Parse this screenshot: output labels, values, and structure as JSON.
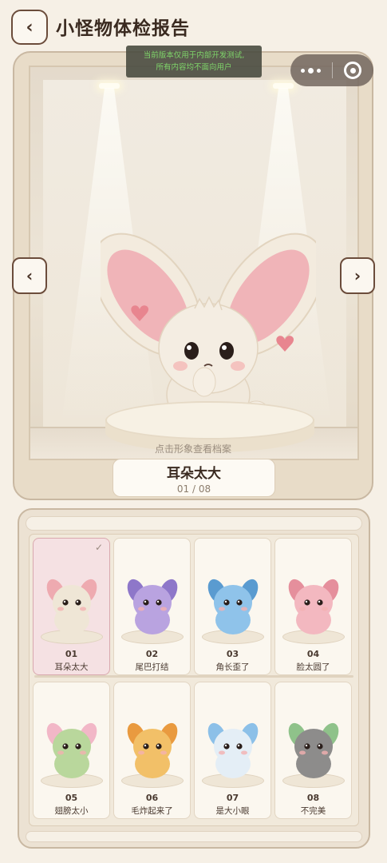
{
  "header": {
    "title": "小怪物体检报告",
    "back_icon": "chevron-left-icon",
    "back_glyph": "‹"
  },
  "dev_notice": {
    "line1": "当前版本仅用于内部开发测试,",
    "line2": "所有内容均不面向用户"
  },
  "capsule": {
    "more_icon": "more-dots-icon",
    "close_icon": "target-circle-icon"
  },
  "showcase": {
    "hint": "点击形象查看档案",
    "prev_glyph": "‹",
    "next_glyph": "›",
    "current": {
      "name": "耳朵太大",
      "index": "01 / 08"
    },
    "colors": {
      "fur": "#efe6d6",
      "ear_inner": "#eeaab0",
      "heart": "#e98a92"
    }
  },
  "grid": {
    "check_glyph": "✓",
    "items": [
      {
        "num": "01",
        "label": "耳朵太大",
        "selected": true,
        "color": "#efe6d6",
        "accent": "#eeaab0"
      },
      {
        "num": "02",
        "label": "尾巴打结",
        "selected": false,
        "color": "#b9a3e0",
        "accent": "#8e77c9"
      },
      {
        "num": "03",
        "label": "角长歪了",
        "selected": false,
        "color": "#8fc3ea",
        "accent": "#5a9bd0"
      },
      {
        "num": "04",
        "label": "脸太圆了",
        "selected": false,
        "color": "#f3b8c0",
        "accent": "#e58f9c"
      },
      {
        "num": "05",
        "label": "翅膀太小",
        "selected": false,
        "color": "#b9d79c",
        "accent": "#f2b7c7"
      },
      {
        "num": "06",
        "label": "毛炸起来了",
        "selected": false,
        "color": "#f2c068",
        "accent": "#e99a3f"
      },
      {
        "num": "07",
        "label": "是大小眼",
        "selected": false,
        "color": "#e4eef6",
        "accent": "#8cc0e8"
      },
      {
        "num": "08",
        "label": "不完美",
        "selected": false,
        "color": "#8d8c8b",
        "accent": "#8fc28a"
      }
    ]
  }
}
